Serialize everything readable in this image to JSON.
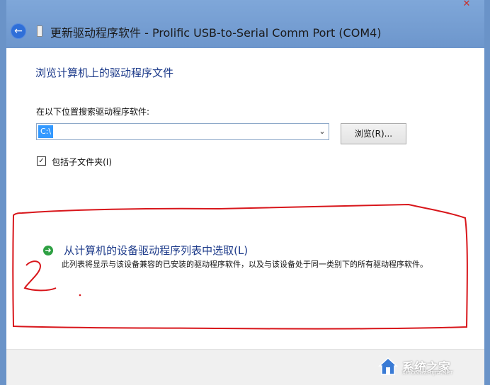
{
  "window": {
    "title": "更新驱动程序软件 - Prolific USB-to-Serial Comm Port (COM4)",
    "back_icon": "back-arrow-icon",
    "device_icon": "usb-device-icon"
  },
  "main": {
    "heading": "浏览计算机上的驱动程序文件",
    "location_label": "在以下位置搜索驱动程序软件:",
    "path_value": "C:\\",
    "browse_button": "浏览(R)...",
    "include_subfolders_label": "包括子文件夹(I)",
    "include_subfolders_checked": true,
    "pick_option_label": "从计算机的设备驱动程序列表中选取(L)",
    "pick_option_icon": "green-arrow-icon",
    "pick_option_desc": "此列表将显示与该设备兼容的已安装的驱动程序软件，以及与该设备处于同一类别下的所有驱动程序软件。"
  },
  "annotation": {
    "handwritten_mark": "2"
  },
  "watermark": {
    "text": "系统之家",
    "sub": "XITONGZHIJIA.NET"
  },
  "colors": {
    "frame": "#6a93c8",
    "link_blue": "#1c3a8a",
    "selection": "#3399ff",
    "annotation_red": "#d8161b"
  }
}
